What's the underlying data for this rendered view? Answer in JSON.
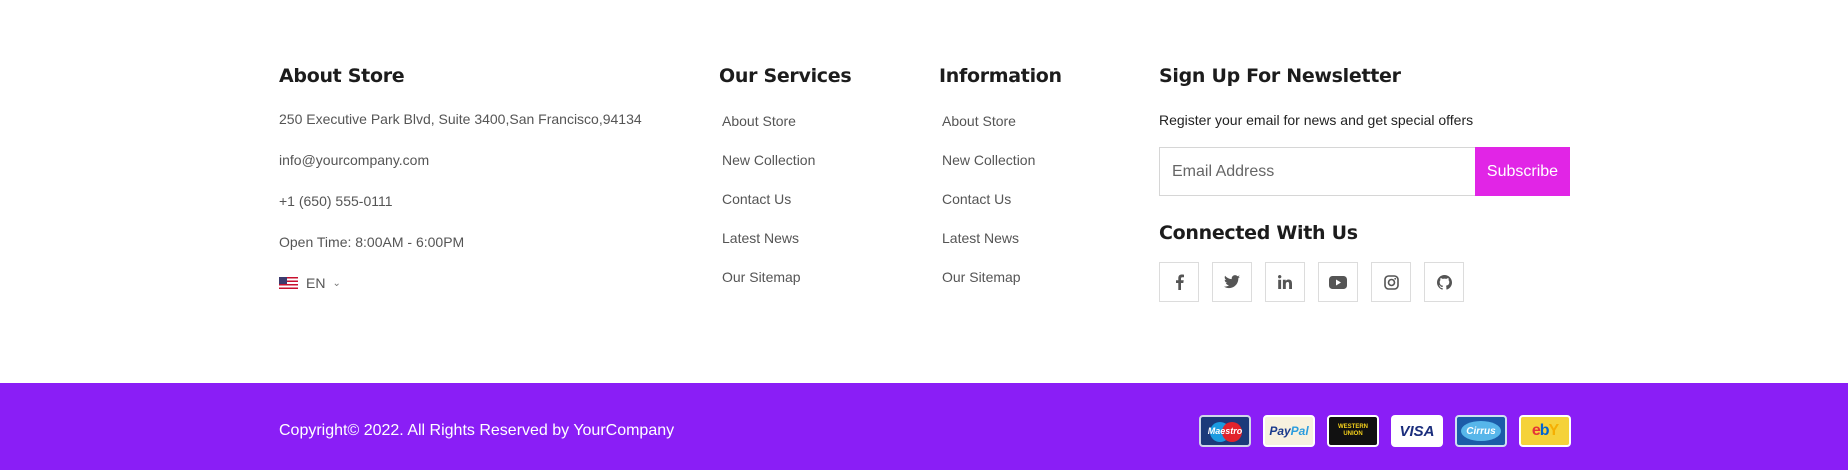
{
  "about": {
    "title": "About Store",
    "address": "250 Executive Park Blvd, Suite 3400,San Francisco,94134",
    "email": "info@yourcompany.com",
    "phone": "+1 (650) 555-0111",
    "hours": "Open Time: 8:00AM - 6:00PM",
    "language": "EN"
  },
  "services": {
    "title": "Our Services",
    "links": [
      "About Store",
      "New Collection",
      "Contact Us",
      "Latest News",
      "Our Sitemap"
    ]
  },
  "information": {
    "title": "Information",
    "links": [
      "About Store",
      "New Collection",
      "Contact Us",
      "Latest News",
      "Our Sitemap"
    ]
  },
  "newsletter": {
    "title": "Sign Up For Newsletter",
    "description": "Register your email for news and get special offers",
    "email_placeholder": "Email Address",
    "subscribe_label": "Subscribe",
    "connected_title": "Connected With Us",
    "socials": [
      "facebook-icon",
      "twitter-icon",
      "linkedin-icon",
      "youtube-icon",
      "instagram-icon",
      "github-icon"
    ]
  },
  "bottom": {
    "copyright": "Copyright© 2022. All Rights Reserved by YourCompany",
    "payments": {
      "maestro": "Maestro",
      "paypal_pay": "Pay",
      "paypal_pal": "Pal",
      "wu_line1": "WESTERN",
      "wu_line2": "UNION",
      "visa": "VISA",
      "cirrus": "Cirrus",
      "ebay": "ebY"
    }
  },
  "colors": {
    "accent_magenta": "#e125e6",
    "bottom_bar_purple": "#8a1ef6"
  }
}
